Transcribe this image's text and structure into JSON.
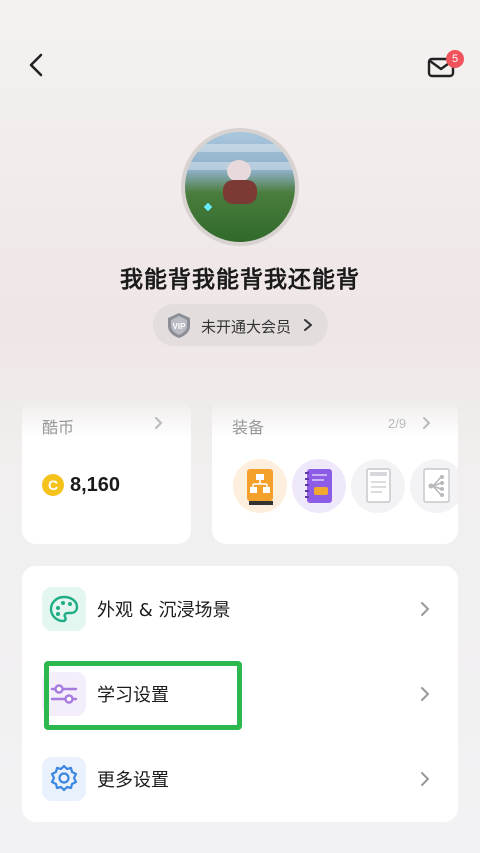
{
  "header": {
    "back_icon": "chevron-left-icon",
    "mail_icon": "envelope-icon",
    "mail_badge": "5"
  },
  "profile": {
    "avatar_icon": "user-avatar-image",
    "username": "我能背我能背我还能背",
    "vip_label": "未开通大会员",
    "vip_icon": "vip-shield-icon"
  },
  "cards": {
    "coins": {
      "title": "酷币",
      "value": "8,160"
    },
    "equipment": {
      "title": "装备",
      "count": "2/9"
    }
  },
  "settings": {
    "items": [
      {
        "label": "外观 & 沉浸场景",
        "icon": "palette-icon"
      },
      {
        "label": "学习设置",
        "icon": "sliders-icon"
      },
      {
        "label": "更多设置",
        "icon": "gear-icon"
      }
    ]
  },
  "colors": {
    "badge": "#f0535c",
    "highlight": "#2db84d",
    "coin": "#f5c21b"
  }
}
